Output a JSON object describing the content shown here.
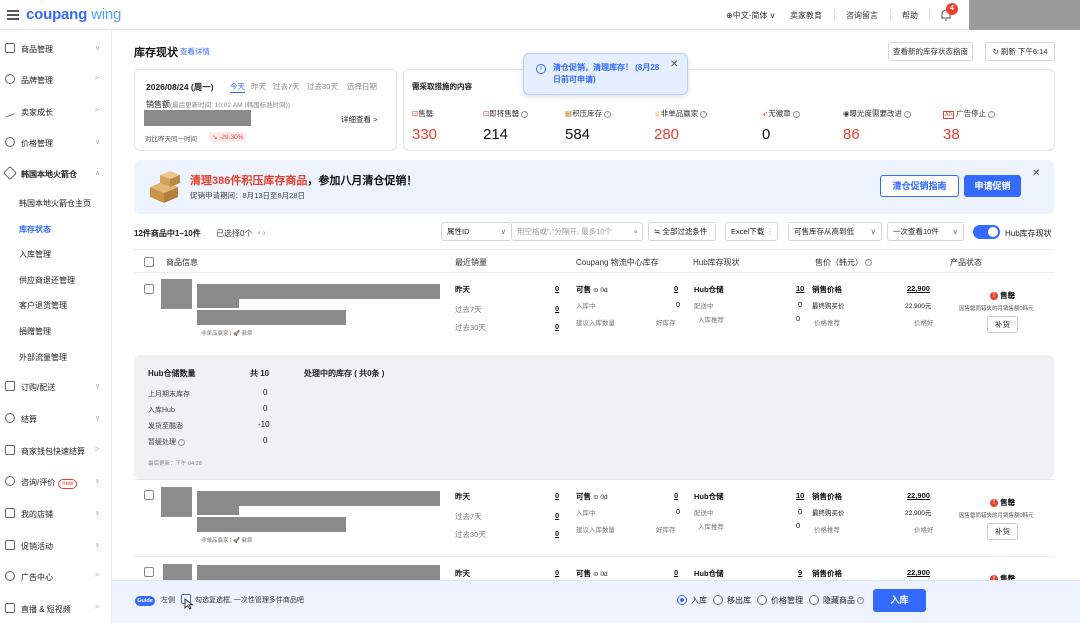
{
  "header": {
    "logo_main": "coupang",
    "logo_sub": "wing",
    "language": "⊕中文-简体 ∨",
    "links": [
      "卖家教育",
      "咨询留言",
      "帮助"
    ],
    "notification_count": "4"
  },
  "sidebar": {
    "items": [
      {
        "label": "商品管理",
        "icon": "box-icon"
      },
      {
        "label": "品牌管理",
        "icon": "shield-icon"
      },
      {
        "label": "卖家成长",
        "icon": "trend-icon"
      },
      {
        "label": "价格管理",
        "icon": "price-tag-icon"
      },
      {
        "label": "韩国本地火箭仓",
        "icon": "rocket-icon"
      }
    ],
    "sub_items": [
      "韩国本地火箭仓主页",
      "库存状态",
      "入库管理",
      "供应商退还管理",
      "客户退货管理",
      "捐赠管理",
      "外部流量管理"
    ],
    "active_sub": "库存状态",
    "items_bottom": [
      {
        "label": "订购/配送",
        "icon": "truck-icon"
      },
      {
        "label": "结算",
        "icon": "won-icon"
      },
      {
        "label": "商家钱包快速结算",
        "icon": "wallet-icon"
      },
      {
        "label": "咨询/评价",
        "icon": "chat-icon",
        "badge": "new"
      },
      {
        "label": "我的店铺",
        "icon": "store-icon"
      },
      {
        "label": "促销活动",
        "icon": "ticket-icon"
      },
      {
        "label": "广告中心",
        "icon": "ad-icon"
      },
      {
        "label": "直播 & 短视频",
        "icon": "video-icon"
      }
    ]
  },
  "page": {
    "title": "库存现状",
    "title_link": "查看详情",
    "guide_button": "查看新的库存状态指南",
    "refresh_button": "刷新 下午6:14"
  },
  "sales_card": {
    "date": "2026/08/24 (周一)",
    "ranges": [
      "今天",
      "昨天",
      "过去7天",
      "过去30天",
      "选择日期"
    ],
    "active_range": "今天",
    "sales_label": "销售额",
    "sales_note": "(最后更新时间: 10:02 AM (韩国标准时间))",
    "detail_link": "详细查看 >",
    "compare_label": "对比昨天同一时间",
    "compare_value": "↘ -29.30%"
  },
  "tooltip": {
    "text": "清仓促销，清理库存！ (8月28日前可申请)"
  },
  "metrics_card": {
    "title": "需采取措施的内容",
    "metrics": [
      {
        "label": "售罄",
        "value": "330",
        "red": true,
        "icon": "sold-out-icon"
      },
      {
        "label": "即将售罄",
        "value": "214",
        "red": false,
        "icon": "almost-sold-out-icon"
      },
      {
        "label": "积压库存",
        "value": "584",
        "red": false,
        "icon": "overstock-icon"
      },
      {
        "label": "非单品赢家",
        "value": "280",
        "red": true,
        "icon": "trophy-icon"
      },
      {
        "label": "无徽章",
        "value": "0",
        "red": false,
        "icon": "rocket-badge-icon"
      },
      {
        "label": "曝光度需要改进",
        "value": "86",
        "red": true,
        "icon": "eye-icon"
      },
      {
        "label": "广告停止",
        "value": "38",
        "red": true,
        "icon": "ad-stop-icon"
      }
    ]
  },
  "banner": {
    "title_red": "清理386件积压库存商品",
    "title_rest": "，参加八月清仓促销！",
    "subtitle": "促销申请期间：8月13日至8月28日",
    "guide_button": "清仓促销指南",
    "apply_button": "申请促销"
  },
  "filters": {
    "count_text": "12件商品中1–10件",
    "selected_text": "已选择0个",
    "attribute_select": "属性ID",
    "search_placeholder": "用空格或\",\"分隔开, 最多10个",
    "all_filters": "全部过滤条件",
    "excel": "Excel下载",
    "sort_select": "可售库存从高到低",
    "page_size_select": "一次查看10件",
    "hub_toggle_label": "Hub库存现状"
  },
  "table": {
    "headers": [
      "商品信息",
      "最近销量",
      "Coupang 物流中心库存",
      "Hub库存现状",
      "售价（韩元）",
      "产品状态"
    ],
    "product_tags": "非单品赢家 | 🚀 徽章",
    "rows": [
      {
        "sales": [
          [
            "昨天",
            "0"
          ],
          [
            "过去7天",
            "0"
          ],
          [
            "过去30天",
            "0"
          ]
        ],
        "fc": {
          "available_label": "可售",
          "days": "0d",
          "available": "0",
          "inbound_label": "入库中",
          "inbound": "0",
          "suggest_label": "建议入库数量",
          "suggest": "好库存"
        },
        "hub": {
          "label": "Hub仓储",
          "value": "10",
          "delivering_label": "配送中",
          "delivering": "0",
          "recommend_label": "入库推荐",
          "recommend": "0"
        },
        "price": {
          "label": "销售价格",
          "value": "22,900",
          "lowest_label": "最终购买价",
          "lowest": "22,900元",
          "recommend_label": "价格推荐",
          "recommend": "价格好"
        },
        "status": {
          "label": "售罄",
          "note": "因售罄而错失的月销售额0韩元",
          "button": "补货"
        }
      },
      {
        "sales": [
          [
            "昨天",
            "0"
          ],
          [
            "过去7天",
            "0"
          ],
          [
            "过去30天",
            "0"
          ]
        ],
        "fc": {
          "available_label": "可售",
          "days": "0d",
          "available": "0",
          "inbound_label": "入库中",
          "inbound": "0",
          "suggest_label": "建议入库数量",
          "suggest": "好库存"
        },
        "hub": {
          "label": "Hub仓储",
          "value": "10",
          "delivering_label": "配送中",
          "delivering": "0",
          "recommend_label": "入库推荐",
          "recommend": "0"
        },
        "price": {
          "label": "销售价格",
          "value": "22,900",
          "lowest_label": "最终购买价",
          "lowest": "22,900元",
          "recommend_label": "价格推荐",
          "recommend": "价格好"
        },
        "status": {
          "label": "售罄",
          "note": "因售罄而错失的月销售额0韩元",
          "button": "补货"
        }
      },
      {
        "sales": [
          [
            "昨天",
            "0"
          ]
        ],
        "fc": {
          "available_label": "可售",
          "days": "0d",
          "available": "0"
        },
        "hub": {
          "label": "Hub仓储",
          "value": "9"
        },
        "price": {
          "label": "销售价格",
          "value": "22,900"
        },
        "status": {
          "label": "售罄"
        }
      }
    ]
  },
  "hub_panel": {
    "title": "Hub仓储数量",
    "total": "共 10",
    "rows": [
      [
        "上月期末库存",
        "0"
      ],
      [
        "入库Hub",
        "0"
      ],
      [
        "发货至酷澎",
        "-10"
      ],
      [
        "暂缓处理",
        "0"
      ]
    ],
    "updated": "最后更新：下午 04:28",
    "processing_title": "处理中的库存 ( 共0条 )"
  },
  "bottom_bar": {
    "guide": "Guide",
    "hint_left": "左侧",
    "hint_right": "勾选复选框, 一次性管理多件商品吧",
    "options": [
      "入库",
      "移出库",
      "价格管理",
      "隐藏商品"
    ],
    "selected_option": "入库",
    "action_button": "入库"
  },
  "colors": {
    "primary": "#346aff",
    "alert": "#e8412d"
  }
}
